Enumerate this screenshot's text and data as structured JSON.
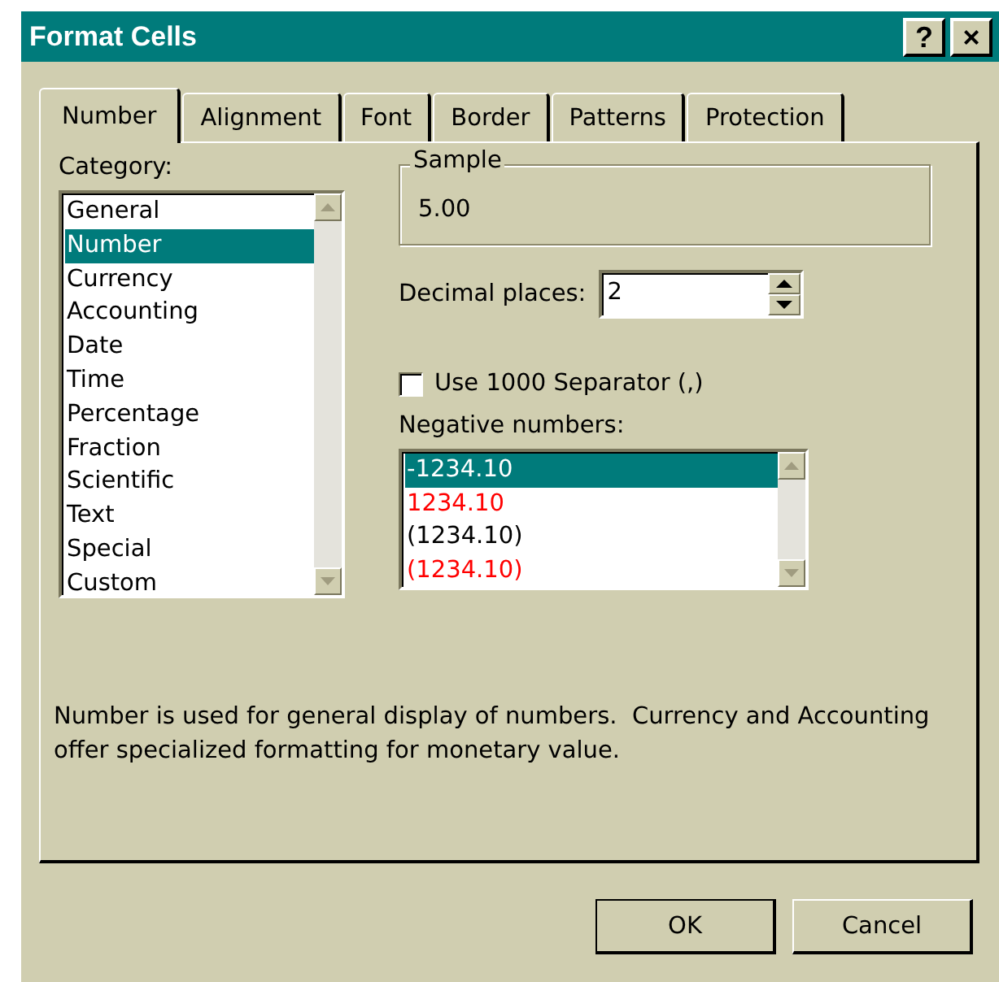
{
  "window": {
    "title": "Format Cells",
    "help_button": "?",
    "close_button": "×"
  },
  "tabs": [
    {
      "label": "Number",
      "selected": true
    },
    {
      "label": "Alignment",
      "selected": false
    },
    {
      "label": "Font",
      "selected": false
    },
    {
      "label": "Border",
      "selected": false
    },
    {
      "label": "Patterns",
      "selected": false
    },
    {
      "label": "Protection",
      "selected": false
    }
  ],
  "category": {
    "label": "Category:",
    "items": [
      {
        "label": "General",
        "selected": false
      },
      {
        "label": "Number",
        "selected": true
      },
      {
        "label": "Currency",
        "selected": false
      },
      {
        "label": "Accounting",
        "selected": false
      },
      {
        "label": "Date",
        "selected": false
      },
      {
        "label": "Time",
        "selected": false
      },
      {
        "label": "Percentage",
        "selected": false
      },
      {
        "label": "Fraction",
        "selected": false
      },
      {
        "label": "Scientific",
        "selected": false
      },
      {
        "label": "Text",
        "selected": false
      },
      {
        "label": "Special",
        "selected": false
      },
      {
        "label": "Custom",
        "selected": false
      }
    ]
  },
  "sample": {
    "label": "Sample",
    "value": "5.00"
  },
  "decimal_places": {
    "label": "Decimal places:",
    "value": "2"
  },
  "separator": {
    "label": "Use 1000 Separator (,)",
    "checked": false
  },
  "negative_numbers": {
    "label": "Negative numbers:",
    "items": [
      {
        "label": "-1234.10",
        "selected": true
      },
      {
        "label": "1234.10",
        "selected": false,
        "color": "#ff0000"
      },
      {
        "label": "(1234.10)",
        "selected": false,
        "color": "#000000"
      },
      {
        "label": "(1234.10)",
        "selected": false,
        "color": "#ff0000"
      }
    ]
  },
  "description": "Number is used for general display of numbers.  Currency and Accounting offer specialized formatting for monetary value.",
  "buttons": [
    "OK",
    "Cancel"
  ]
}
